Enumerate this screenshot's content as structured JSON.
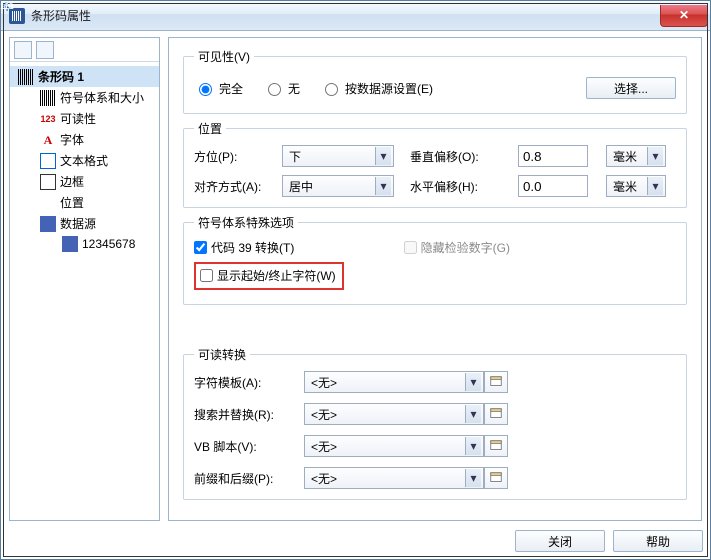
{
  "titlebar": {
    "title": "条形码属性",
    "close_glyph": "✕"
  },
  "tree": {
    "root": "条形码 1",
    "items": [
      "符号体系和大小",
      "可读性",
      "字体",
      "文本格式",
      "边框",
      "位置",
      "数据源"
    ],
    "readable_prefix": "123",
    "font_glyph": "A",
    "data_child": "12345678"
  },
  "visibility": {
    "legend": "可见性(V)",
    "opt_full": "完全",
    "opt_none": "无",
    "opt_by_data": "按数据源设置(E)",
    "select_btn": "选择..."
  },
  "position": {
    "legend": "位置",
    "orient_label": "方位(P):",
    "orient_value": "下",
    "align_label": "对齐方式(A):",
    "align_value": "居中",
    "voffset_label": "垂直偏移(O):",
    "voffset_value": "0.8",
    "hoffset_label": "水平偏移(H):",
    "hoffset_value": "0.0",
    "unit": "毫米"
  },
  "symbol_opts": {
    "legend": "符号体系特殊选项",
    "code39": "代码 39 转换(T)",
    "show_start_stop": "显示起始/终止字符(W)",
    "hide_check_digit": "隐藏检验数字(G)"
  },
  "readable_conv": {
    "legend": "可读转换",
    "tmpl_label": "字符模板(A):",
    "search_label": "搜索并替换(R):",
    "vb_label": "VB 脚本(V):",
    "prefix_label": "前缀和后缀(P):",
    "none_value": "<无>"
  },
  "footer": {
    "close": "关闭",
    "help": "帮助"
  },
  "glyphs": {
    "dropdown": "▾"
  }
}
